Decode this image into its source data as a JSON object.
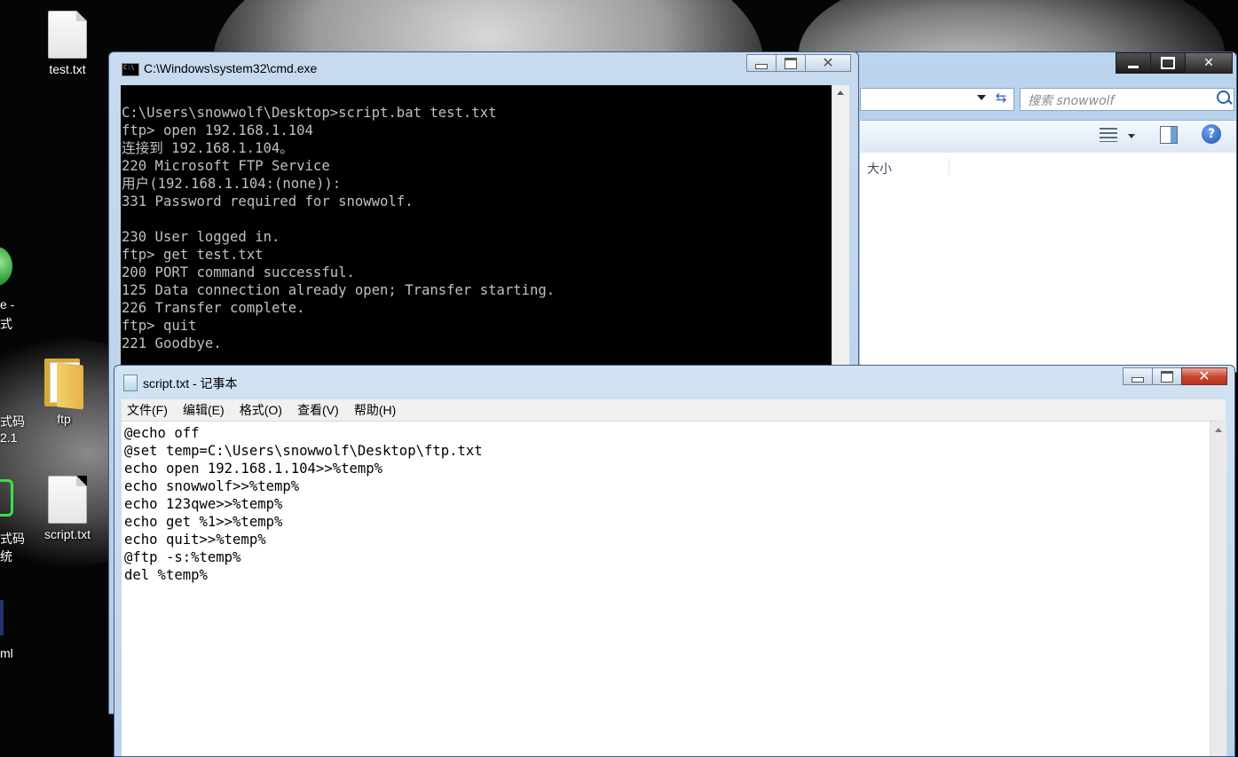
{
  "desktop": {
    "icons": [
      {
        "label": "test.txt"
      },
      {
        "label": "ftp"
      },
      {
        "label": "script.txt"
      }
    ],
    "clipped_labels": [
      "e -",
      "式",
      "式码",
      "2.1",
      "式码",
      "统",
      "ml"
    ]
  },
  "explorer": {
    "search_placeholder": "搜索 snowwolf",
    "column_header": "大小",
    "help_label": "?"
  },
  "cmd": {
    "title": "C:\\Windows\\system32\\cmd.exe",
    "lines": [
      "C:\\Users\\snowwolf\\Desktop>script.bat test.txt",
      "ftp> open 192.168.1.104",
      "连接到 192.168.1.104。",
      "220 Microsoft FTP Service",
      "用户(192.168.1.104:(none)):",
      "331 Password required for snowwolf.",
      "",
      "230 User logged in.",
      "ftp> get test.txt",
      "200 PORT command successful.",
      "125 Data connection already open; Transfer starting.",
      "226 Transfer complete.",
      "ftp> quit",
      "221 Goodbye."
    ]
  },
  "notepad": {
    "title": "script.txt - 记事本",
    "menu": [
      "文件(F)",
      "编辑(E)",
      "格式(O)",
      "查看(V)",
      "帮助(H)"
    ],
    "lines": [
      "@echo off",
      "@set temp=C:\\Users\\snowwolf\\Desktop\\ftp.txt",
      "echo open 192.168.1.104>>%temp%",
      "echo snowwolf>>%temp%",
      "echo 123qwe>>%temp%",
      "echo get %1>>%temp%",
      "echo quit>>%temp%",
      "@ftp -s:%temp%",
      "del %temp%"
    ]
  }
}
